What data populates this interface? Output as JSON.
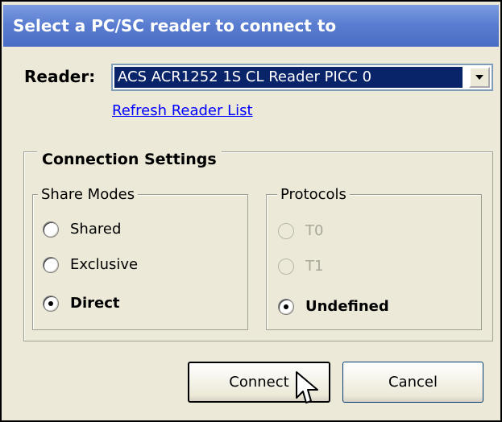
{
  "dialog": {
    "title": "Select a PC/SC reader to connect to"
  },
  "reader": {
    "label": "Reader:",
    "selected": "ACS ACR1252 1S CL Reader PICC 0",
    "refresh_link": "Refresh Reader List"
  },
  "connection_settings": {
    "legend": "Connection Settings",
    "share_modes": {
      "legend": "Share Modes",
      "options": [
        {
          "label": "Shared",
          "checked": false,
          "enabled": true
        },
        {
          "label": "Exclusive",
          "checked": false,
          "enabled": true
        },
        {
          "label": "Direct",
          "checked": true,
          "enabled": true
        }
      ]
    },
    "protocols": {
      "legend": "Protocols",
      "options": [
        {
          "label": "T0",
          "checked": false,
          "enabled": false
        },
        {
          "label": "T1",
          "checked": false,
          "enabled": false
        },
        {
          "label": "Undefined",
          "checked": true,
          "enabled": true
        }
      ]
    }
  },
  "buttons": {
    "connect": "Connect",
    "cancel": "Cancel"
  },
  "icons": {
    "dropdown": "chevron-down-icon",
    "cursor": "mouse-pointer-icon"
  },
  "colors": {
    "title_bar": "#5b7ed1",
    "selection": "#0a246a",
    "link": "#0000ff",
    "dialog_bg": "#ece9d8"
  }
}
